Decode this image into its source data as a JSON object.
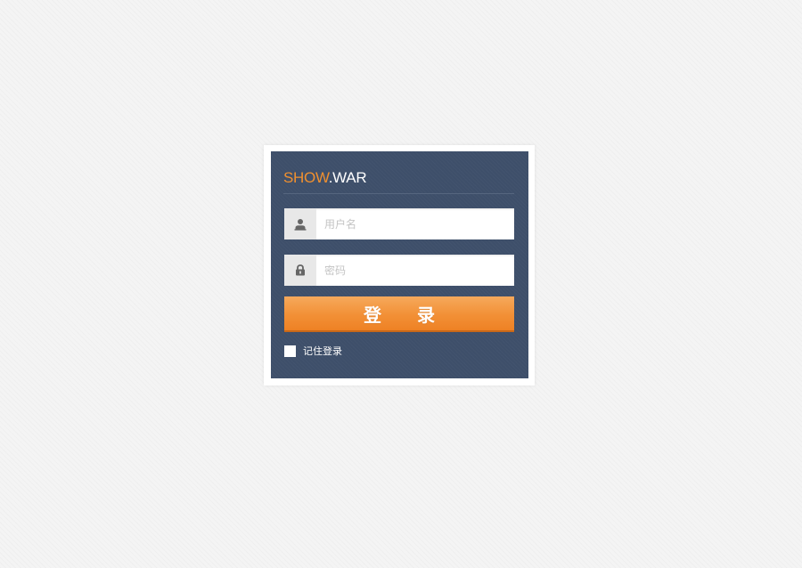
{
  "logo": {
    "part1": "SHOW",
    "part2": ".WAR"
  },
  "form": {
    "username_placeholder": "用户名",
    "password_placeholder": "密码",
    "username_icon": "user-icon",
    "password_icon": "lock-icon",
    "submit_label": "登录",
    "remember_label": "记住登录",
    "remember_checked": false
  },
  "colors": {
    "panel_bg": "#3e4f6a",
    "accent": "#f29036",
    "logo_accent": "#f0902f"
  }
}
